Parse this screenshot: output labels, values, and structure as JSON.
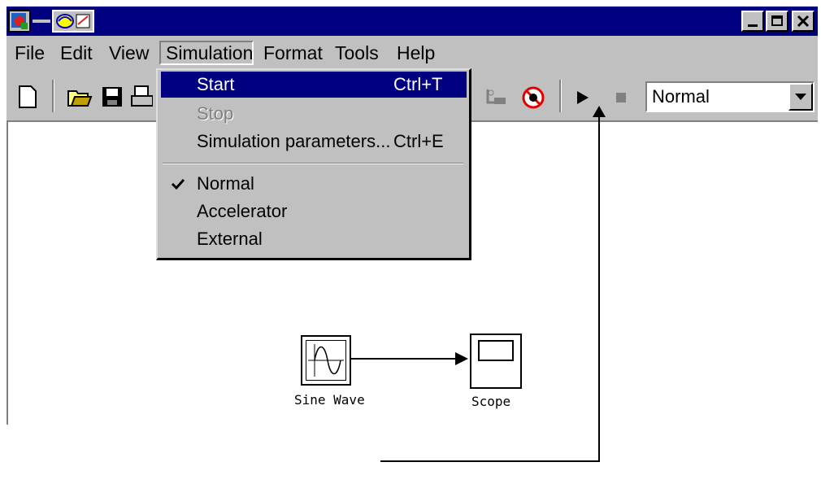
{
  "menubar": {
    "file": "File",
    "edit": "Edit",
    "view": "View",
    "simulation": "Simulation",
    "format": "Format",
    "tools": "Tools",
    "help": "Help"
  },
  "simulation_menu": {
    "start": "Start",
    "start_shortcut": "Ctrl+T",
    "stop": "Stop",
    "parameters": "Simulation parameters...",
    "parameters_shortcut": "Ctrl+E",
    "normal": "Normal",
    "accelerator": "Accelerator",
    "external": "External",
    "checked_item": "Normal"
  },
  "toolbar": {
    "mode_value": "Normal"
  },
  "blocks": {
    "sine_wave": "Sine Wave",
    "scope": "Scope"
  },
  "icons": [
    "app-icon",
    "model-browser-icon",
    "debug-icon",
    "new-icon",
    "open-icon",
    "save-icon",
    "print-icon",
    "library-icon",
    "debugger-icon",
    "start-icon",
    "stop-icon",
    "minimize-icon",
    "maximize-icon",
    "close-icon"
  ],
  "colors": {
    "titlebar": "#000080",
    "highlight": "#000080",
    "chrome": "#c0c0c0"
  }
}
